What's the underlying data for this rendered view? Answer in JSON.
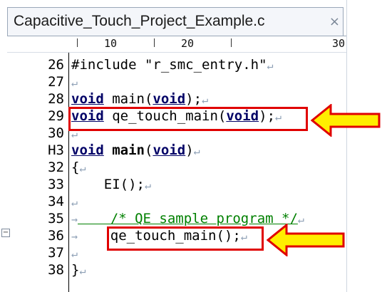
{
  "tab": {
    "title": "Capacitive_Touch_Project_Example.c",
    "close_glyph": "×"
  },
  "ruler": {
    "marks": [
      "10",
      "20",
      "30"
    ]
  },
  "lines": [
    {
      "num": "26",
      "code": "#include \"r_smc_entry.h\""
    },
    {
      "num": "27",
      "code": ""
    },
    {
      "num": "28",
      "code": "void main(void);"
    },
    {
      "num": "29",
      "code": "void qe_touch_main(void);"
    },
    {
      "num": "30",
      "code": ""
    },
    {
      "num": "H3",
      "code": "void main(void)"
    },
    {
      "num": "32",
      "code": "{"
    },
    {
      "num": "33",
      "code": "    EI();"
    },
    {
      "num": "34",
      "code": ""
    },
    {
      "num": "35",
      "code": "    /* QE sample program */"
    },
    {
      "num": "36",
      "code": "    qe_touch_main();"
    },
    {
      "num": "37",
      "code": ""
    },
    {
      "num": "38",
      "code": "}"
    }
  ],
  "glyphs": {
    "eol": "↵",
    "tab_arrow": "→",
    "fold": "−"
  },
  "colors": {
    "highlight": "#e00000",
    "arrow_fill": "#ffee00",
    "arrow_stroke": "#e00000",
    "keyword": "#000066",
    "comment": "#008000"
  }
}
